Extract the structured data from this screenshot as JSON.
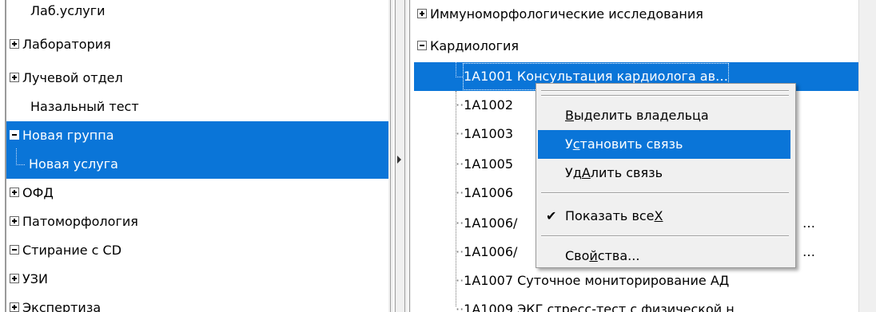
{
  "left_tree": {
    "items": [
      {
        "label": "Лаб.услуги",
        "expander": "none"
      },
      {
        "label": "Лаборатория",
        "expander": "plus"
      },
      {
        "label": "Лучевой отдел",
        "expander": "plus"
      },
      {
        "label": "Назальный тест",
        "expander": "none"
      },
      {
        "label": "Новая группа",
        "expander": "minus",
        "selected": true
      },
      {
        "label": "Новая услуга",
        "expander": "child",
        "selected": true
      },
      {
        "label": "ОФД",
        "expander": "plus"
      },
      {
        "label": "Патоморфология",
        "expander": "plus"
      },
      {
        "label": "Стирание с CD",
        "expander": "minus"
      },
      {
        "label": "УЗИ",
        "expander": "plus"
      },
      {
        "label": "Экспертиза",
        "expander": "plus"
      }
    ]
  },
  "right_tree": {
    "items": [
      {
        "label": "Иммуноморфологические исследования",
        "expander": "plus"
      },
      {
        "label": "Кардиология",
        "expander": "minus"
      },
      {
        "label": "1A1001 Консультация кардиолога ав…",
        "selected": true
      },
      {
        "label": "1A1002 ",
        "expander": "child"
      },
      {
        "label": "1A1003 ",
        "expander": "child"
      },
      {
        "label": "1A1005 ",
        "expander": "child"
      },
      {
        "label": "1A1006 ",
        "expander": "child"
      },
      {
        "label": "1A1006/",
        "tail": "…"
      },
      {
        "label": "1A1006/",
        "tail": "…"
      },
      {
        "label": "1A1007 Суточное мониторирование АД",
        "expander": "child"
      },
      {
        "label": "1A1009 ЭКГ стресс-тест с физической н…",
        "expander": "child"
      }
    ]
  },
  "context_menu": {
    "items": [
      {
        "label_pre": "",
        "label_ul": "В",
        "label_post": "ыделить владельца"
      },
      {
        "label_pre": "У",
        "label_ul": "с",
        "label_post": "тановить связь",
        "highlighted": true
      },
      {
        "label_pre": "Уд",
        "label_ul": "А",
        "label_post": "лить связь"
      },
      {
        "label_pre": "Показать все",
        "label_ul": "Х",
        "label_post": "",
        "checked": true
      },
      {
        "label_pre": "Сво",
        "label_ul": "й",
        "label_post": "ства..."
      }
    ],
    "check_glyph": "✔"
  },
  "colors": {
    "selection": "#0a75d8"
  }
}
